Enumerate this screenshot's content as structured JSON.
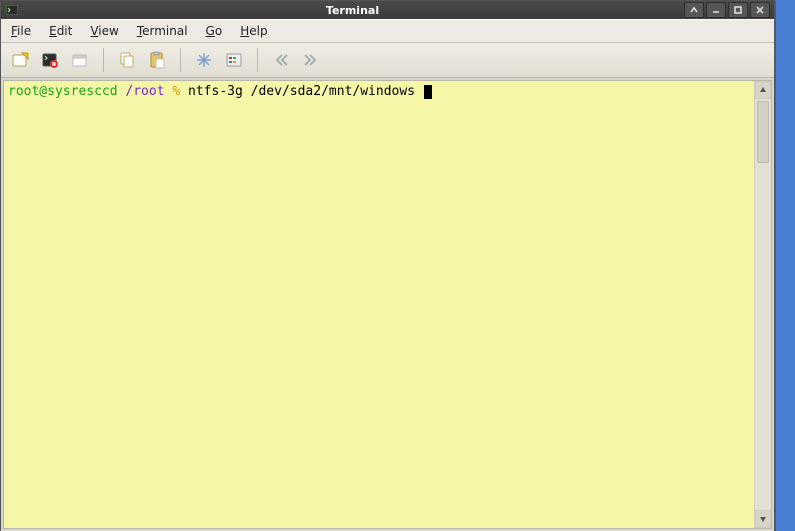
{
  "window": {
    "title": "Terminal"
  },
  "menu": {
    "file": "File",
    "edit": "Edit",
    "view": "View",
    "terminal": "Terminal",
    "go": "Go",
    "help": "Help"
  },
  "toolbar": {
    "new_tab": "New Tab",
    "close_tab": "Close Tab",
    "new_window": "New Window",
    "copy": "Copy",
    "paste": "Paste",
    "fullscreen": "Fullscreen",
    "preferences": "Preferences",
    "prev_tab": "Previous Tab",
    "next_tab": "Next Tab"
  },
  "prompt": {
    "user": "root@sysresccd",
    "path": "/root",
    "symbol": "%",
    "command": "ntfs-3g /dev/sda2/mnt/windows"
  },
  "colors": {
    "desktop": "#4a80d4",
    "terminal_bg": "#f5f7a6",
    "prompt_user": "#1aa514",
    "prompt_path": "#7a26c9",
    "prompt_symbol": "#d69b00"
  }
}
